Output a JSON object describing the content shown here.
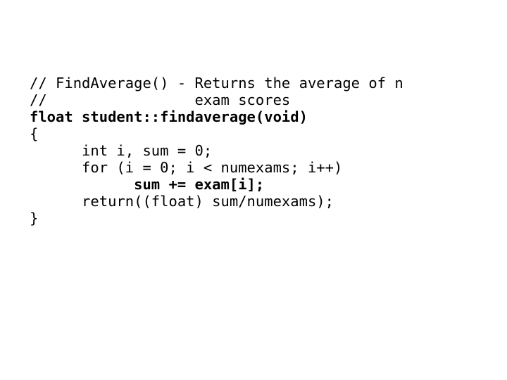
{
  "slide": {
    "background_color": "#ffffff",
    "text_color": "#000000",
    "language": "cpp"
  },
  "code": {
    "lines": [
      {
        "text": "// FindAverage() - Returns the average of n",
        "bold": false
      },
      {
        "text": "//                 exam scores",
        "bold": false
      },
      {
        "text": "float student::findaverage(void)",
        "bold": true
      },
      {
        "text": "{",
        "bold": false
      },
      {
        "text": "      int i, sum = 0;",
        "bold": false
      },
      {
        "text": "      for (i = 0; i < numexams; i++)",
        "bold": false
      },
      {
        "text": "            sum += exam[i];",
        "bold": true
      },
      {
        "text": "      return((float) sum/numexams);",
        "bold": false
      },
      {
        "text": "}",
        "bold": false
      }
    ]
  }
}
